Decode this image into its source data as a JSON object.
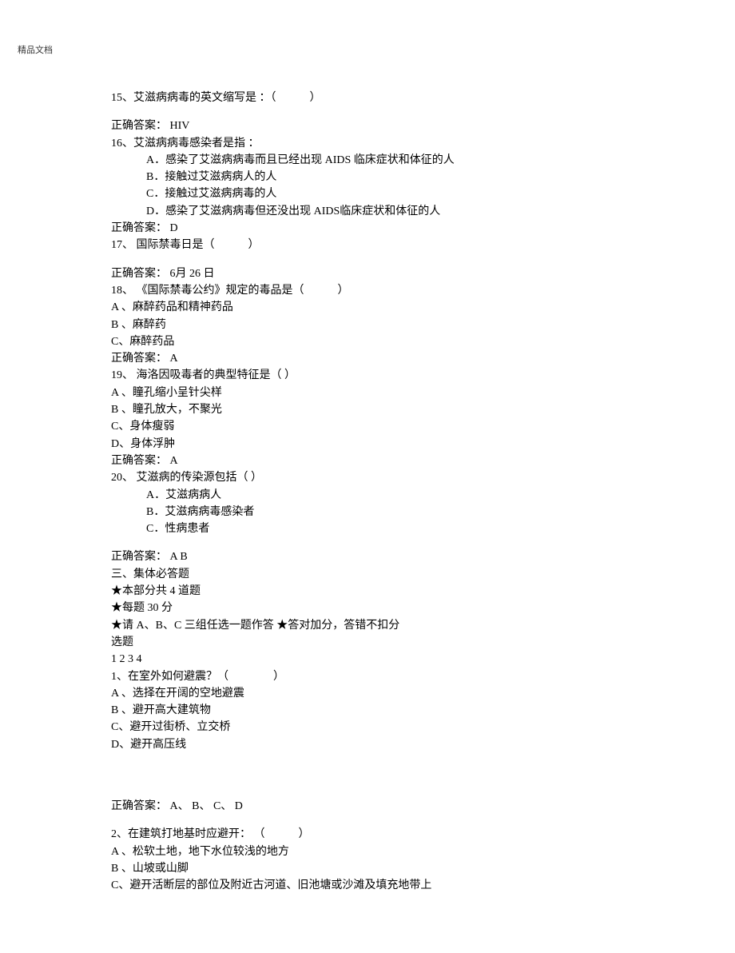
{
  "header": {
    "label": "精品文档"
  },
  "q15": {
    "text": "15、艾滋病病毒的英文缩写是 ：（　　　）",
    "answer": "正确答案： HIV"
  },
  "q16": {
    "text": "16、艾滋病病毒感染者是指 ：",
    "optA": "A．感染了艾滋病病毒而且已经出现 AIDS 临床症状和体征的人",
    "optB": "B．接触过艾滋病病人的人",
    "optC": "C．接触过艾滋病病毒的人",
    "optD": "D．感染了艾滋病病毒但还没出现 AIDS临床症状和体征的人",
    "answer": "正确答案： D"
  },
  "q17": {
    "text": "17、 国际禁毒日是（　　　）",
    "answer": "正确答案： 6月 26 日"
  },
  "q18": {
    "text": "18、 《国际禁毒公约》规定的毒品是（　　　）",
    "optA": "A 、麻醉药品和精神药品",
    "optB": "B 、麻醉药",
    "optC": "C、麻醉药品",
    "answer": "正确答案： A"
  },
  "q19": {
    "text": "19、 海洛因吸毒者的典型特征是（ ）",
    "optA": "A 、瞳孔缩小呈针尖样",
    "optB": "B 、瞳孔放大，不聚光",
    "optC": "C、身体瘦弱",
    "optD": "D、身体浮肿",
    "answer": "正确答案： A"
  },
  "q20": {
    "text": "20、 艾滋病的传染源包括（ ）",
    "optA": "A．艾滋病病人",
    "optB": "B．艾滋病病毒感染者",
    "optC": "C．性病患者",
    "answer": "正确答案： A B"
  },
  "section3": {
    "title": "三、集体必答题",
    "rule1": "★本部分共 4 道题",
    "rule2": "★每题 30 分",
    "rule3": "★请 A、B、C 三组任选一题作答 ★答对加分，答错不扣分",
    "pick": "选题",
    "nums": "1 2 3 4"
  },
  "sq1": {
    "text": "1、在室外如何避震？（　　　　）",
    "optA": "A 、选择在开阔的空地避震",
    "optB": "B 、避开高大建筑物",
    "optC": "C、避开过街桥、立交桥",
    "optD": "D、避开高压线",
    "answer": "正确答案： A、 B、 C、 D"
  },
  "sq2": {
    "text": "2、在建筑打地基时应避开： （　　　）",
    "optA": "A 、松软土地，地下水位较浅的地方",
    "optB": "B 、山坡或山脚",
    "optC": "C、避开活断层的部位及附近古河道、旧池塘或沙滩及填充地带上"
  }
}
